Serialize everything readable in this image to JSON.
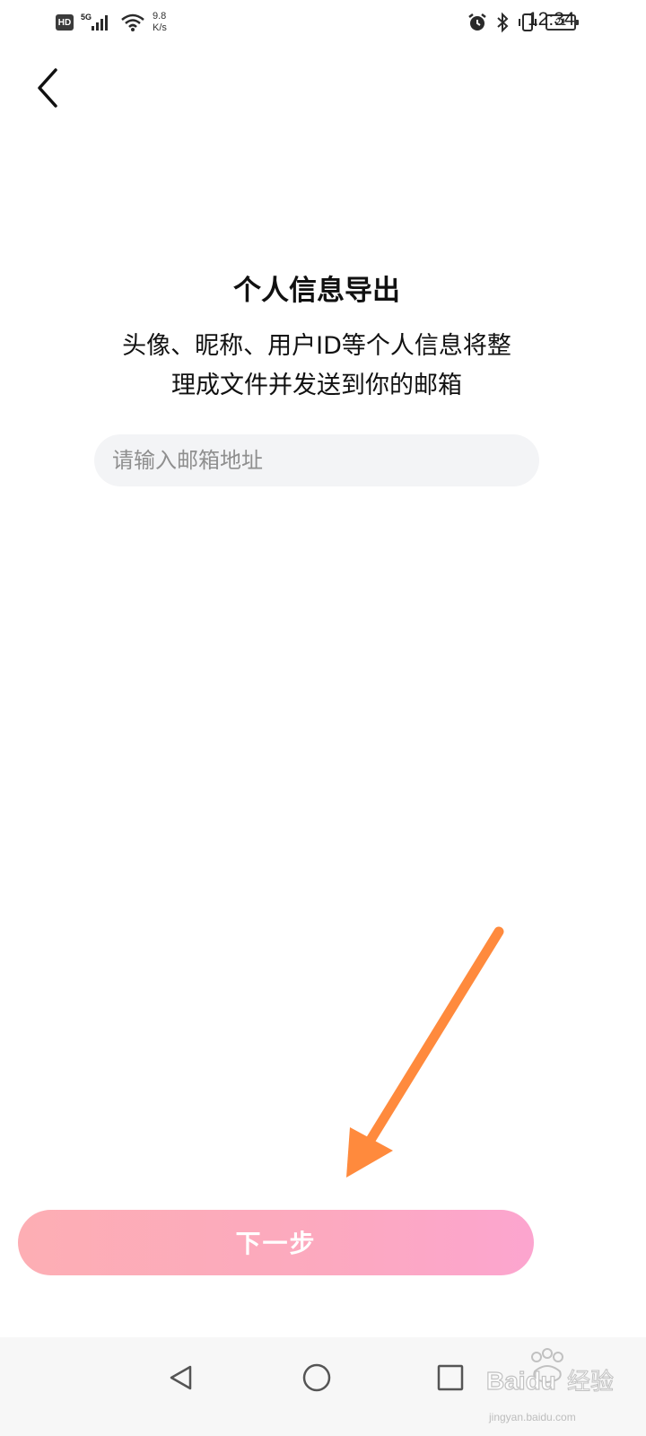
{
  "status_bar": {
    "hd_label": "HD",
    "network_label": "5G",
    "speed_value": "9.8",
    "speed_unit": "K/s",
    "battery_level": "21",
    "time": "12:34"
  },
  "header": {
    "back_icon": "chevron-left-icon"
  },
  "main": {
    "title": "个人信息导出",
    "description_line1": "头像、昵称、用户ID等个人信息将整",
    "description_line2": "理成文件并发送到你的邮箱",
    "email_placeholder": "请输入邮箱地址",
    "email_value": ""
  },
  "footer": {
    "next_label": "下一步"
  },
  "annotation": {
    "arrow_color": "#ff8a3d"
  },
  "nav_bar": {
    "back_icon": "triangle-back-icon",
    "home_icon": "circle-home-icon",
    "recents_icon": "square-recents-icon"
  },
  "watermark": {
    "brand": "Baidu",
    "cn_text": "经验",
    "url": "jingyan.baidu.com"
  },
  "colors": {
    "button_start": "#fdaeb4",
    "button_end": "#fca5cf",
    "input_bg": "#f3f4f6"
  }
}
